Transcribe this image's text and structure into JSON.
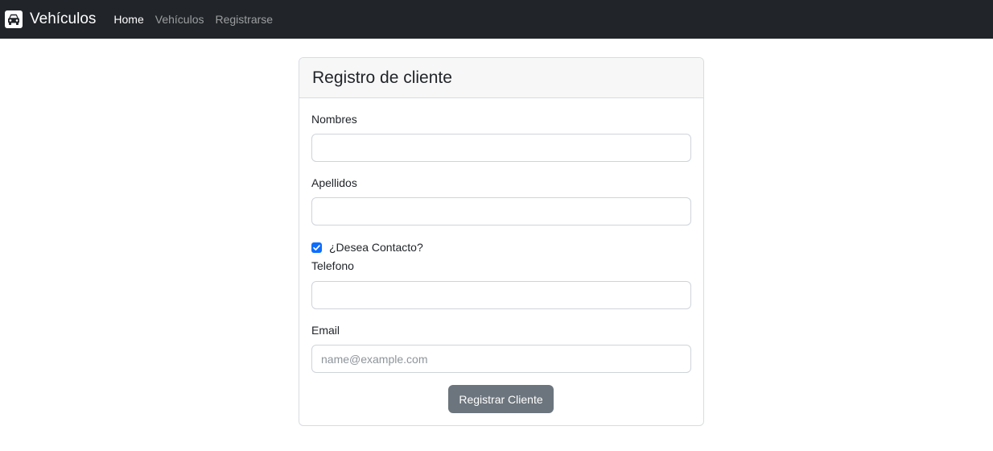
{
  "navbar": {
    "brand_icon": "car-icon",
    "brand": "Vehículos",
    "links": [
      {
        "label": "Home",
        "active": true
      },
      {
        "label": "Vehículos",
        "active": false
      },
      {
        "label": "Registrarse",
        "active": false
      }
    ]
  },
  "form": {
    "title": "Registro de cliente",
    "nombres_label": "Nombres",
    "nombres_value": "",
    "apellidos_label": "Apellidos",
    "apellidos_value": "",
    "contact_label": "¿Desea Contacto?",
    "contact_checked": true,
    "telefono_label": "Telefono",
    "telefono_value": "",
    "email_label": "Email",
    "email_value": "",
    "email_placeholder": "name@example.com",
    "submit_label": "Registrar Cliente"
  },
  "colors": {
    "navbar_bg": "#212529",
    "checkbox": "#0d6efd",
    "button": "#6c757d"
  }
}
